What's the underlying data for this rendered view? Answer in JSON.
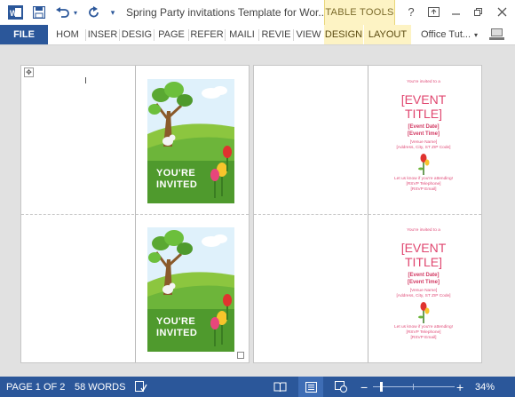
{
  "titlebar": {
    "doc_title": "Spring Party invitations Template for Wor...",
    "context_label": "TABLE TOOLS",
    "help": "?"
  },
  "ribbon": {
    "file": "FILE",
    "tabs": [
      "HOM",
      "INSER",
      "DESIG",
      "PAGE",
      "REFER",
      "MAILI",
      "REVIE",
      "VIEW"
    ],
    "context_tabs": [
      "DESIGN",
      "LAYOUT"
    ],
    "account": "Office Tut..."
  },
  "card": {
    "line1": "YOU'RE",
    "line2": "INVITED"
  },
  "inner": {
    "intro": "You're invited to a",
    "title1": "[EVENT",
    "title2": "TITLE]",
    "date": "[Event Date]",
    "time": "[Event Time]",
    "venue": "[Venue Name]",
    "address": "[Address, City, ST ZIP Code]",
    "rsvp_intro": "Let us know if you're attending!",
    "rsvp_phone": "[RSVP Telephone]",
    "rsvp_email": "[RSVP Email]"
  },
  "status": {
    "page": "PAGE 1 OF 2",
    "words": "58 WORDS",
    "zoom": "34%"
  },
  "colors": {
    "brand": "#2b579a",
    "context": "#fdf3c4",
    "invite_pink": "#e04b78",
    "grass": "#6db53a"
  }
}
